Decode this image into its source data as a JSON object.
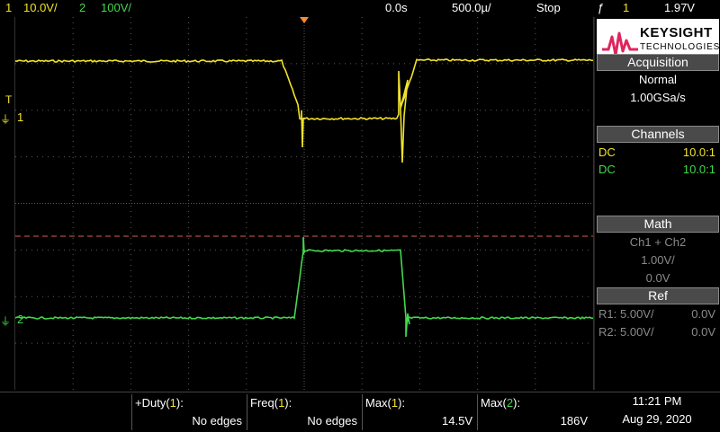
{
  "topbar": {
    "ch1_num": "1",
    "ch1_scale": "10.0V/",
    "ch2_num": "2",
    "ch2_scale": "100V/",
    "time_offset": "0.0s",
    "time_scale": "500.0µ/",
    "run_state": "Stop",
    "trigger_icon": "ƒ",
    "trigger_channel": "1",
    "trigger_level": "1.97V"
  },
  "markers": {
    "ch1_label": "1",
    "ch2_label": "2",
    "trigger_level_marker": "T"
  },
  "panel": {
    "brand": "KEYSIGHT",
    "brand_sub": "TECHNOLOGIES",
    "acquisition_header": "Acquisition",
    "acq_mode": "Normal",
    "acq_rate": "1.00GSa/s",
    "channels_header": "Channels",
    "ch1_coupling": "DC",
    "ch1_probe": "10.0:1",
    "ch2_coupling": "DC",
    "ch2_probe": "10.0:1",
    "math_header": "Math",
    "math_func": "Ch1 + Ch2",
    "math_scale": "1.00V/",
    "math_offset": "0.0V",
    "ref_header": "Ref",
    "r1_label": "R1:",
    "r1_scale": "5.00V/",
    "r1_offset": "0.0V",
    "r2_label": "R2:",
    "r2_scale": "5.00V/",
    "r2_offset": "0.0V"
  },
  "measurements": [
    {
      "label_pre": "+Duty(",
      "ch": "1",
      "label_post": "):",
      "value": "No edges"
    },
    {
      "label_pre": "Freq(",
      "ch": "1",
      "label_post": "):",
      "value": "No edges"
    },
    {
      "label_pre": "Max(",
      "ch": "1",
      "label_post": "):",
      "value": "14.5V"
    },
    {
      "label_pre": "Max(",
      "ch": "2",
      "label_post": "):",
      "value": "186V"
    }
  ],
  "clock": {
    "time": "11:21 PM",
    "date": "Aug 29, 2020"
  },
  "colors": {
    "ch1": "#f2e32a",
    "ch2": "#42d94a",
    "trigger_line": "#d9604a",
    "grid": "#5a5a5a",
    "accent": "#e0245e"
  }
}
